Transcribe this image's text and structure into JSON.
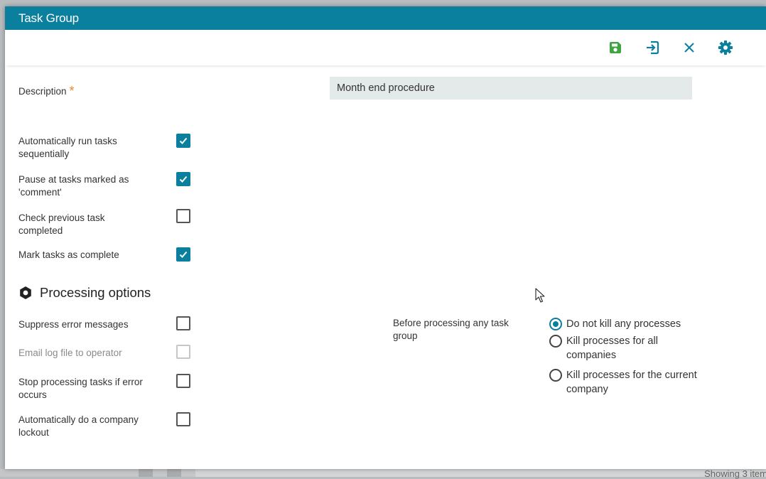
{
  "window": {
    "title": "Task Group"
  },
  "toolbar": {
    "buttons": [
      {
        "name": "save",
        "icon": "save-icon",
        "color": "#3fa540"
      },
      {
        "name": "exit",
        "icon": "exit-icon",
        "color": "#0a7f9e"
      },
      {
        "name": "close",
        "icon": "close-icon",
        "color": "#0a7f9e"
      },
      {
        "name": "settings",
        "icon": "gear-icon",
        "color": "#0a7f9e"
      }
    ]
  },
  "description": {
    "label": "Description",
    "required_marker": "*",
    "value": "Month end procedure"
  },
  "options": [
    {
      "label": "Automatically run tasks sequentially",
      "checked": true
    },
    {
      "label": "Pause at tasks marked as 'comment'",
      "checked": true
    },
    {
      "label": "Check previous task completed",
      "checked": false
    },
    {
      "label": "Mark tasks as complete",
      "checked": true
    }
  ],
  "processing": {
    "title": "Processing options",
    "icon": "gear-icon",
    "options": [
      {
        "label": "Suppress error messages",
        "checked": false,
        "disabled": false
      },
      {
        "label": "Email log file to operator",
        "checked": false,
        "disabled": true
      },
      {
        "label": "Stop processing tasks if error occurs",
        "checked": false,
        "disabled": false
      },
      {
        "label": "Automatically do a company lockout",
        "checked": false,
        "disabled": false
      }
    ],
    "before_label": "Before processing any task group",
    "radios": [
      {
        "label": "Do not kill any processes",
        "selected": true
      },
      {
        "label": "Kill processes for all companies",
        "selected": false
      },
      {
        "label": "Kill processes for the current company",
        "selected": false
      }
    ]
  },
  "background": {
    "status_text": "Showing 3 item"
  },
  "colors": {
    "accent": "#0a7f9e",
    "save": "#3fa540",
    "required": "#f0871f",
    "input_bg": "#e4e9ea"
  }
}
